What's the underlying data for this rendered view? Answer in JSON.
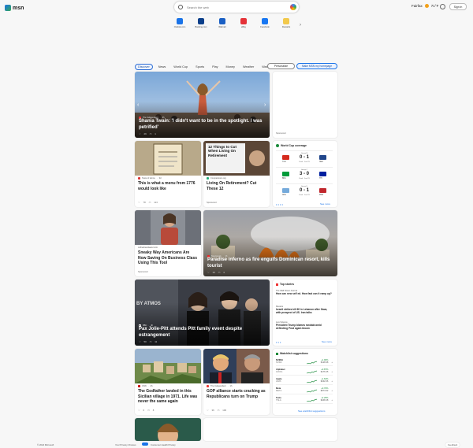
{
  "header": {
    "logo": "msn",
    "search_placeholder": "Search the web",
    "location": "Fairfax",
    "temperature": "71°F",
    "sign_in": "Sign in"
  },
  "quicklinks": [
    {
      "label": "Outlook.com",
      "color": "#1a73e8"
    },
    {
      "label": "Booking.com",
      "color": "#0b3f8a"
    },
    {
      "label": "Walmart",
      "color": "#1a5fc4"
    },
    {
      "label": "eBay",
      "color": "#e53238"
    },
    {
      "label": "Facebook",
      "color": "#1877f2"
    },
    {
      "label": "Rewards",
      "color": "#f2c94c"
    }
  ],
  "nav": {
    "tabs": [
      "Discover",
      "News",
      "World Cup",
      "Sports",
      "Play",
      "Money",
      "Weather",
      "Watch",
      "···"
    ],
    "personalize": "Personalize",
    "homepage": "Make MSN my homepage"
  },
  "hero": {
    "source": "The Independent",
    "time": "3h",
    "title": "Shania Twain: 'I didn't want to be in the spotlight. I was petrified'",
    "likes": "29",
    "comments": "1"
  },
  "ad1": {
    "label": "Sponsored"
  },
  "card_menu": {
    "source": "Taste of Home",
    "time": "3d",
    "title": "This is what a menu from 1776 would look like",
    "likes": "78",
    "comments": "113"
  },
  "card_retire": {
    "source": "Comparisons.org",
    "title": "Living On Retirement? Cut These 12",
    "label": "Sponsored",
    "overlay": "12 Things to Cut When Living On Retirement"
  },
  "worldcup": {
    "title": "World Cup coverage",
    "matches": [
      {
        "group": "Group B",
        "score": "0 - 1",
        "status": "Final · Jan 23",
        "t1": "TUR",
        "t2": "NED",
        "c1": "#d52b1e",
        "c2": "#21468b"
      },
      {
        "group": "Group C",
        "score": "3 - 0",
        "status": "Final · Jan 23",
        "t1": "BRA",
        "t2": "HTI",
        "c1": "#009b3a",
        "c2": "#00209f"
      },
      {
        "group": "Group D",
        "score": "0 - 1",
        "status": "Final · Jan 23",
        "t1": "ARG",
        "t2": "MAR",
        "c1": "#75aadb",
        "c2": "#c1272d"
      }
    ],
    "see_more": "See more"
  },
  "card_travel": {
    "source": "onlinetravelsaver.com",
    "title": "Sneaky Way Americans Are Now Saving On Business Class Using This Tool",
    "label": "Sponsored"
  },
  "card_fire": {
    "source": "Newsweek",
    "time": "1h",
    "title": "Paradise inferno as fire engulfs Dominican resort, kills tourist",
    "likes": "19",
    "comments": "4"
  },
  "card_jolie": {
    "source": "BBC",
    "time": "4h",
    "title": "Pax Jolie-Pitt attends Pitt family event despite estrangement",
    "likes": "50",
    "comments": "11",
    "tag": "BY ATMOS"
  },
  "top_stories": {
    "title": "Top stories",
    "items": [
      {
        "source": "The Wall Street Journal",
        "title": "How can new self ed. How fast can it ramp up?"
      },
      {
        "source": "Reuters",
        "title": "Israeli strikes kill 60 in Lebanon after Gaza, with prospect of US. Iran talks"
      },
      {
        "source": "Live Science",
        "title": "President Trump blames randabi amid deflecting Prod again bloom"
      }
    ],
    "see_more": "See more"
  },
  "card_godfather": {
    "source": "CNN",
    "time": "4h",
    "title": "The Godfather landed in this Sicilian village in 1971. Life was never the same again",
    "likes": "6",
    "comments": "8"
  },
  "card_gop": {
    "source": "The Independent",
    "time": "1h",
    "title": "GOP alliance starts cracking as Republicans turn on Trump",
    "likes": "36",
    "comments": "106"
  },
  "watchlist": {
    "title": "Watchlist suggestions",
    "rows": [
      {
        "name": "NVIDIA",
        "sub": "NVDA",
        "price": "+1.96%",
        "last": "$128.98"
      },
      {
        "name": "Alphabet",
        "sub": "GOOG",
        "price": "+0.87%",
        "last": "$176.35"
      },
      {
        "name": "Apple",
        "sub": "AAPL",
        "price": "+1.64%",
        "last": "$232.66"
      },
      {
        "name": "Meta",
        "sub": "META",
        "price": "+0.70%",
        "last": "$574.92"
      },
      {
        "name": "Tesla",
        "sub": "TSLA",
        "price": "+2.25%",
        "last": "$248.48"
      }
    ],
    "see_more": "See watchlist suggestions"
  },
  "footer": {
    "copyright": "© 2024 Microsoft",
    "privacy": "Your Privacy Choices",
    "consumer": "Consumer Health Privacy",
    "feedback": "Feedback"
  }
}
